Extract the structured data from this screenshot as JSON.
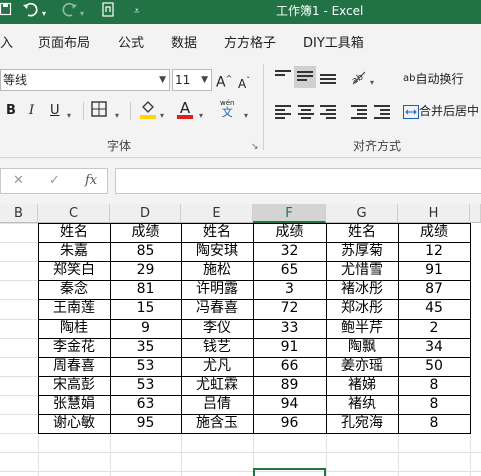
{
  "titlebar": {
    "title": "工作簿1  -  Excel",
    "icons": [
      "save-icon",
      "undo-icon",
      "redo-icon",
      "touch-mode-icon",
      "customize-qat-icon"
    ]
  },
  "tabs": [
    "入",
    "页面布局",
    "公式",
    "数据",
    "方方格子",
    "DIY工具箱"
  ],
  "ribbon": {
    "font_name": "等线",
    "font_size": "11",
    "grow_font": "A",
    "shrink_font": "A",
    "bold": "B",
    "italic": "I",
    "underline": "U",
    "font_color_letter": "A",
    "phonetic_top": "wén",
    "phonetic_bottom": "文",
    "font_group_label": "字体",
    "wrap_text": "自动换行",
    "merge_center": "合并后居中",
    "alignment_group_label": "对齐方式",
    "wrap_icon_text": "ab",
    "fill_color": "#ffd400",
    "font_color": "#e02020",
    "accent": "#217346"
  },
  "formula_bar": {
    "cancel": "✕",
    "enter": "✓",
    "fx": "fx"
  },
  "sheet": {
    "columns": [
      "B",
      "C",
      "D",
      "E",
      "F",
      "G",
      "H"
    ],
    "selected_column": "F",
    "header": [
      "姓名",
      "成绩",
      "姓名",
      "成绩",
      "姓名",
      "成绩"
    ],
    "rows": [
      [
        "朱嘉",
        "85",
        "陶安琪",
        "32",
        "苏厚菊",
        "12"
      ],
      [
        "郑笑白",
        "29",
        "施松",
        "65",
        "尤惜雪",
        "91"
      ],
      [
        "秦念",
        "81",
        "许明露",
        "3",
        "褚冰彤",
        "87"
      ],
      [
        "王南莲",
        "15",
        "冯春喜",
        "72",
        "郑冰彤",
        "45"
      ],
      [
        "陶桂",
        "9",
        "李仪",
        "33",
        "鲍半芹",
        "2"
      ],
      [
        "李金花",
        "35",
        "钱艺",
        "91",
        "陶飘",
        "34"
      ],
      [
        "周春喜",
        "53",
        "尤凡",
        "66",
        "姜亦瑶",
        "50"
      ],
      [
        "宋高彭",
        "53",
        "尤虹霖",
        "89",
        "褚娣",
        "8"
      ],
      [
        "张慧娟",
        "63",
        "吕倩",
        "94",
        "褚纨",
        "8"
      ],
      [
        "谢心敏",
        "95",
        "施含玉",
        "96",
        "孔宛海",
        "8"
      ]
    ]
  }
}
